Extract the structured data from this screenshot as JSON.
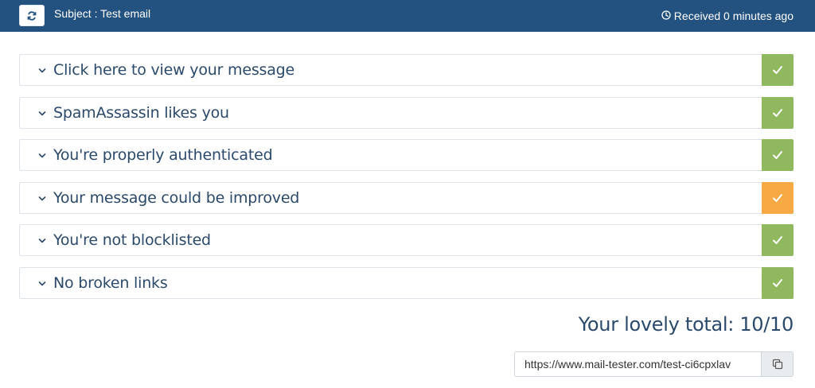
{
  "header": {
    "subject": "Subject : Test email",
    "received": "Received 0 minutes ago",
    "refresh_icon": "refresh-icon",
    "clock_icon": "clock-icon",
    "background_color": "#245280"
  },
  "checks": [
    {
      "label": "Click here to view your message",
      "status": "ok"
    },
    {
      "label": "SpamAssassin likes you",
      "status": "ok"
    },
    {
      "label": "You're properly authenticated",
      "status": "ok"
    },
    {
      "label": "Your message could be improved",
      "status": "warn"
    },
    {
      "label": "You're not blocklisted",
      "status": "ok"
    },
    {
      "label": "No broken links",
      "status": "ok"
    }
  ],
  "status_colors": {
    "ok": "#8fb85f",
    "warn": "#f7a944"
  },
  "total": "Your lovely total: 10/10",
  "share": {
    "url": "https://www.mail-tester.com/test-ci6cpxlav",
    "copy_icon": "copy-icon"
  }
}
